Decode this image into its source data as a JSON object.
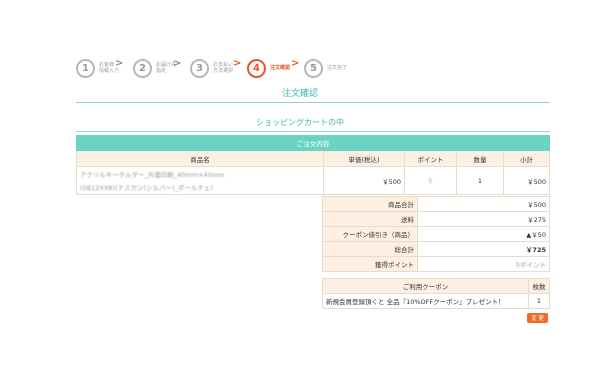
{
  "steps": [
    {
      "num": "1",
      "label": "お客様\n情報入力",
      "active": false
    },
    {
      "num": "2",
      "label": "お届け先\n指定",
      "active": false
    },
    {
      "num": "3",
      "label": "お支払い\n方法選択",
      "active": false
    },
    {
      "num": "4",
      "label": "注文確認",
      "active": true
    },
    {
      "num": "5",
      "label": "注文完了",
      "active": false
    }
  ],
  "step_separator": ">",
  "page_title": "注文確認",
  "section_title": "ショッピングカートの中",
  "cart": {
    "caption": "ご注文内容",
    "headers": [
      "商品名",
      "単価(税込)",
      "ポイント",
      "数量",
      "小計"
    ],
    "rows": [
      {
        "name_line1": "アクリルキーホルダー_片面印刷_40mm×40mm",
        "name_line2": "(SB12XX8)(ナスカン(シルバー)_ボールチェ)",
        "unit_price": "￥500",
        "points": "5",
        "qty": "1",
        "subtotal": "￥500"
      }
    ]
  },
  "summary": [
    {
      "label": "商品合計",
      "value": "￥500",
      "bold": false
    },
    {
      "label": "送料",
      "value": "￥275",
      "bold": false
    },
    {
      "label": "クーポン値引き（商品）",
      "value": "▲￥50",
      "bold": false
    },
    {
      "label": "総合計",
      "value": "￥725",
      "bold": true
    },
    {
      "label": "獲得ポイント",
      "value": "5ポイント",
      "bold": false
    }
  ],
  "coupon": {
    "header_name": "ご利用クーポン",
    "header_count": "枚数",
    "rows": [
      {
        "name": "新規会員登録頂くと 全品『10%OFFクーポン』プレゼント！",
        "count": "1"
      }
    ]
  },
  "change_button": "変 更",
  "colors": {
    "accent": "#3fb7a6",
    "active_step": "#e8562a",
    "button": "#f06a2a",
    "table_header": "#6bd3c1"
  }
}
